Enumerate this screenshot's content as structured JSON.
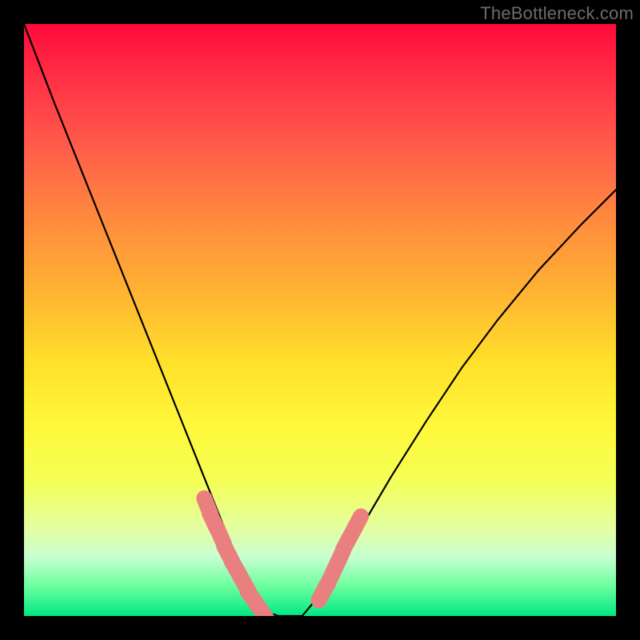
{
  "watermark": "TheBottleneck.com",
  "chart_data": {
    "type": "line",
    "title": "",
    "xlabel": "",
    "ylabel": "",
    "xlim": [
      0,
      1
    ],
    "ylim": [
      0,
      1
    ],
    "series": [
      {
        "name": "curve",
        "x": [
          0.0,
          0.05,
          0.1,
          0.15,
          0.2,
          0.25,
          0.3,
          0.34,
          0.37,
          0.4,
          0.43,
          0.47,
          0.52,
          0.57,
          0.62,
          0.68,
          0.74,
          0.8,
          0.87,
          0.94,
          1.0
        ],
        "y": [
          1.0,
          0.87,
          0.745,
          0.62,
          0.495,
          0.37,
          0.245,
          0.145,
          0.075,
          0.01,
          0.0,
          0.0,
          0.06,
          0.15,
          0.235,
          0.33,
          0.42,
          0.5,
          0.585,
          0.66,
          0.72
        ]
      },
      {
        "name": "marker-band-left",
        "x": [
          0.31,
          0.32,
          0.332,
          0.345,
          0.358,
          0.372,
          0.386,
          0.4
        ],
        "y": [
          0.185,
          0.16,
          0.135,
          0.105,
          0.08,
          0.055,
          0.03,
          0.01
        ]
      },
      {
        "name": "marker-band-right",
        "x": [
          0.505,
          0.518,
          0.532,
          0.546,
          0.562
        ],
        "y": [
          0.04,
          0.065,
          0.095,
          0.125,
          0.155
        ]
      }
    ],
    "marker_color": "#e97f7f",
    "curve_color": "#000000"
  },
  "gradient_stops": [
    {
      "pos": 0.0,
      "color": "#ff0a3a"
    },
    {
      "pos": 0.08,
      "color": "#ff2b45"
    },
    {
      "pos": 0.2,
      "color": "#ff5a4a"
    },
    {
      "pos": 0.33,
      "color": "#ff8a3e"
    },
    {
      "pos": 0.45,
      "color": "#ffb233"
    },
    {
      "pos": 0.57,
      "color": "#ffe02a"
    },
    {
      "pos": 0.68,
      "color": "#fff83a"
    },
    {
      "pos": 0.77,
      "color": "#f4ff55"
    },
    {
      "pos": 0.85,
      "color": "#e4ffa0"
    },
    {
      "pos": 0.9,
      "color": "#c8ffd0"
    },
    {
      "pos": 0.95,
      "color": "#6cff9e"
    },
    {
      "pos": 1.0,
      "color": "#00e884"
    }
  ]
}
